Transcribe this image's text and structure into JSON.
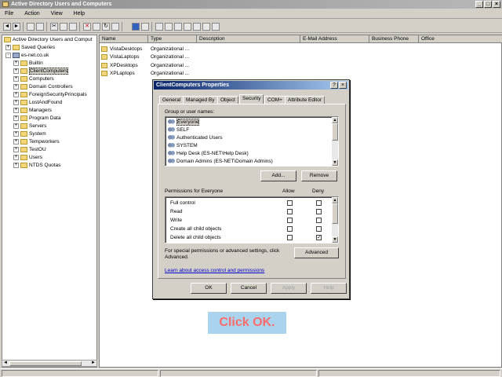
{
  "window": {
    "title": "Active Directory Users and Computers",
    "min": "_",
    "max": "□",
    "close": "×"
  },
  "menu": [
    "File",
    "Action",
    "View",
    "Help"
  ],
  "tree": [
    {
      "label": "Active Directory Users and Comput",
      "exp": "",
      "level": 0
    },
    {
      "label": "Saved Queries",
      "exp": "+",
      "level": 1
    },
    {
      "label": "es-net.co.uk",
      "exp": "-",
      "level": 1
    },
    {
      "label": "Builtin",
      "exp": "+",
      "level": 2
    },
    {
      "label": "ClientComputers",
      "exp": "+",
      "level": 2,
      "selected": true
    },
    {
      "label": "Computers",
      "exp": "+",
      "level": 2
    },
    {
      "label": "Domain Controllers",
      "exp": "+",
      "level": 2
    },
    {
      "label": "ForeignSecurityPrincipals",
      "exp": "+",
      "level": 2
    },
    {
      "label": "LostAndFound",
      "exp": "+",
      "level": 2
    },
    {
      "label": "Managers",
      "exp": "+",
      "level": 2
    },
    {
      "label": "Program Data",
      "exp": "+",
      "level": 2
    },
    {
      "label": "Servers",
      "exp": "+",
      "level": 2
    },
    {
      "label": "System",
      "exp": "+",
      "level": 2
    },
    {
      "label": "Tempworkers",
      "exp": "+",
      "level": 2
    },
    {
      "label": "TestOU",
      "exp": "+",
      "level": 2
    },
    {
      "label": "Users",
      "exp": "+",
      "level": 2
    },
    {
      "label": "NTDS Quotas",
      "exp": "+",
      "level": 2
    }
  ],
  "columns": [
    "Name",
    "Type",
    "Description",
    "E-Mail Address",
    "Business Phone",
    "Office"
  ],
  "rows": [
    {
      "name": "VistaDesktops",
      "type": "Organizational ..."
    },
    {
      "name": "VistaLaptops",
      "type": "Organizational ..."
    },
    {
      "name": "XPDesktops",
      "type": "Organizational ..."
    },
    {
      "name": "XPLaptops",
      "type": "Organizational ..."
    }
  ],
  "dialog": {
    "title": "ClientComputers Properties",
    "help_btn": "?",
    "close_btn": "×",
    "tabs": [
      "General",
      "Managed By",
      "Object",
      "Security",
      "COM+",
      "Attribute Editor"
    ],
    "active_tab": "Security",
    "group_label": "Group or user names:",
    "users": [
      "Everyone",
      "SELF",
      "Authenticated Users",
      "SYSTEM",
      "Help Desk (ES-NET\\Help Desk)",
      "Domain Admins (ES-NET\\Domain Admins)"
    ],
    "selected_user": "Everyone",
    "add_btn": "Add...",
    "remove_btn": "Remove",
    "perm_label": "Permissions for Everyone",
    "allow_label": "Allow",
    "deny_label": "Deny",
    "permissions": [
      {
        "name": "Full control",
        "allow": false,
        "deny": false
      },
      {
        "name": "Read",
        "allow": false,
        "deny": false
      },
      {
        "name": "Write",
        "allow": false,
        "deny": false
      },
      {
        "name": "Create all child objects",
        "allow": false,
        "deny": false
      },
      {
        "name": "Delete all child objects",
        "allow": false,
        "deny": true
      }
    ],
    "special_text_1": "For special permissions or advanced settings, click",
    "special_text_2": "Advanced.",
    "advanced_btn": "Advanced",
    "learn_link": "Learn about access control and permissions",
    "ok": "OK",
    "cancel": "Cancel",
    "apply": "Apply",
    "help": "Help"
  },
  "callout": "Click OK.",
  "colors": {
    "callout_bg": "#aad4ee",
    "callout_text": "#ff6a6a",
    "dialog_title": "#0a246a"
  }
}
